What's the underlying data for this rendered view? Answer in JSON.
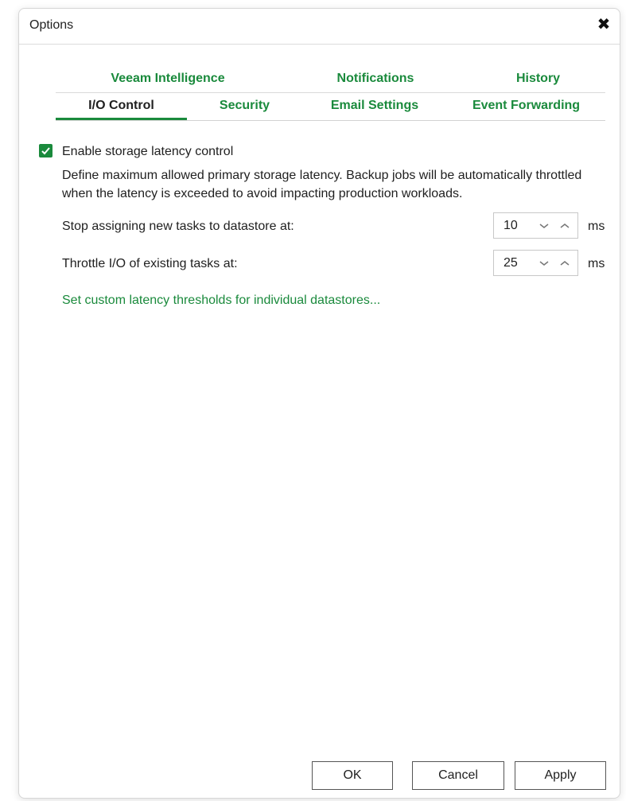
{
  "window": {
    "title": "Options",
    "close_icon": "close-icon"
  },
  "tabs": {
    "row1": [
      {
        "label": "Veeam Intelligence",
        "active": false
      },
      {
        "label": "Notifications",
        "active": false
      },
      {
        "label": "History",
        "active": false
      }
    ],
    "row2": [
      {
        "label": "I/O Control",
        "active": true
      },
      {
        "label": "Security",
        "active": false
      },
      {
        "label": "Email Settings",
        "active": false
      },
      {
        "label": "Event Forwarding",
        "active": false
      }
    ]
  },
  "io_control": {
    "enable_label": "Enable storage latency control",
    "enable_checked": true,
    "description": "Define maximum allowed primary storage latency. Backup jobs will be automatically throttled when the latency is exceeded to avoid impacting production workloads.",
    "stop_label": "Stop assigning new tasks to datastore at:",
    "stop_value": "10",
    "throttle_label": "Throttle I/O of existing tasks at:",
    "throttle_value": "25",
    "unit": "ms",
    "custom_link": "Set custom latency thresholds for individual datastores..."
  },
  "buttons": {
    "ok": "OK",
    "cancel": "Cancel",
    "apply": "Apply"
  },
  "colors": {
    "accent": "#1a8a3c"
  }
}
